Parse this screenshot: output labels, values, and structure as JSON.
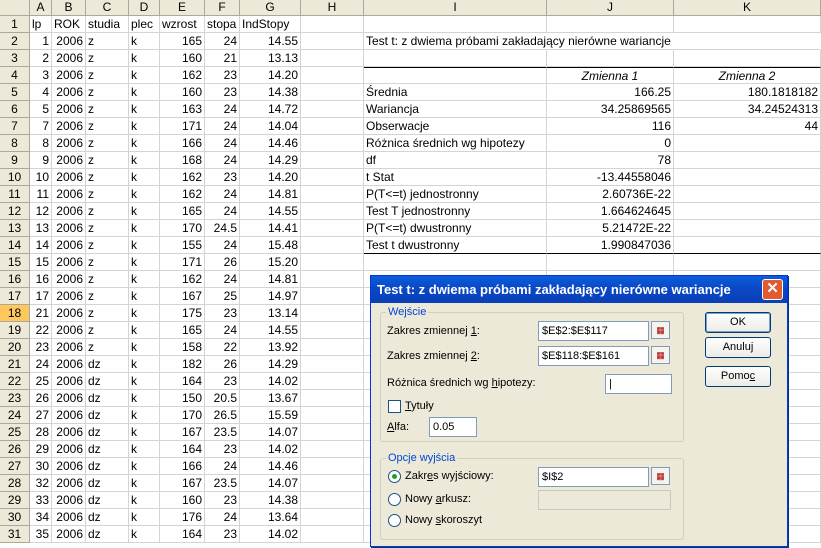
{
  "columns": [
    {
      "letter": "A",
      "w": 22
    },
    {
      "letter": "B",
      "w": 34
    },
    {
      "letter": "C",
      "w": 43
    },
    {
      "letter": "D",
      "w": 31
    },
    {
      "letter": "E",
      "w": 45
    },
    {
      "letter": "F",
      "w": 35
    },
    {
      "letter": "G",
      "w": 61
    },
    {
      "letter": "H",
      "w": 63
    },
    {
      "letter": "I",
      "w": 183
    },
    {
      "letter": "J",
      "w": 127
    },
    {
      "letter": "K",
      "w": 147
    }
  ],
  "rows": [
    {
      "n": "1",
      "lp": "lp",
      "rok": "ROK",
      "studia": "studia",
      "plec": "plec",
      "wzrost": "wzrost",
      "stopa": "stopa",
      "ind": "IndStopy"
    },
    {
      "n": "2",
      "lp": "1",
      "rok": "2006",
      "studia": "z",
      "plec": "k",
      "wzrost": "165",
      "stopa": "24",
      "ind": "14.55"
    },
    {
      "n": "3",
      "lp": "2",
      "rok": "2006",
      "studia": "z",
      "plec": "k",
      "wzrost": "160",
      "stopa": "21",
      "ind": "13.13"
    },
    {
      "n": "4",
      "lp": "3",
      "rok": "2006",
      "studia": "z",
      "plec": "k",
      "wzrost": "162",
      "stopa": "23",
      "ind": "14.20"
    },
    {
      "n": "5",
      "lp": "4",
      "rok": "2006",
      "studia": "z",
      "plec": "k",
      "wzrost": "160",
      "stopa": "23",
      "ind": "14.38"
    },
    {
      "n": "6",
      "lp": "5",
      "rok": "2006",
      "studia": "z",
      "plec": "k",
      "wzrost": "163",
      "stopa": "24",
      "ind": "14.72"
    },
    {
      "n": "7",
      "lp": "7",
      "rok": "2006",
      "studia": "z",
      "plec": "k",
      "wzrost": "171",
      "stopa": "24",
      "ind": "14.04"
    },
    {
      "n": "8",
      "lp": "8",
      "rok": "2006",
      "studia": "z",
      "plec": "k",
      "wzrost": "166",
      "stopa": "24",
      "ind": "14.46"
    },
    {
      "n": "9",
      "lp": "9",
      "rok": "2006",
      "studia": "z",
      "plec": "k",
      "wzrost": "168",
      "stopa": "24",
      "ind": "14.29"
    },
    {
      "n": "10",
      "lp": "10",
      "rok": "2006",
      "studia": "z",
      "plec": "k",
      "wzrost": "162",
      "stopa": "23",
      "ind": "14.20"
    },
    {
      "n": "11",
      "lp": "11",
      "rok": "2006",
      "studia": "z",
      "plec": "k",
      "wzrost": "162",
      "stopa": "24",
      "ind": "14.81"
    },
    {
      "n": "12",
      "lp": "12",
      "rok": "2006",
      "studia": "z",
      "plec": "k",
      "wzrost": "165",
      "stopa": "24",
      "ind": "14.55"
    },
    {
      "n": "13",
      "lp": "13",
      "rok": "2006",
      "studia": "z",
      "plec": "k",
      "wzrost": "170",
      "stopa": "24.5",
      "ind": "14.41"
    },
    {
      "n": "14",
      "lp": "14",
      "rok": "2006",
      "studia": "z",
      "plec": "k",
      "wzrost": "155",
      "stopa": "24",
      "ind": "15.48"
    },
    {
      "n": "15",
      "lp": "15",
      "rok": "2006",
      "studia": "z",
      "plec": "k",
      "wzrost": "171",
      "stopa": "26",
      "ind": "15.20"
    },
    {
      "n": "16",
      "lp": "16",
      "rok": "2006",
      "studia": "z",
      "plec": "k",
      "wzrost": "162",
      "stopa": "24",
      "ind": "14.81"
    },
    {
      "n": "17",
      "lp": "17",
      "rok": "2006",
      "studia": "z",
      "plec": "k",
      "wzrost": "167",
      "stopa": "25",
      "ind": "14.97"
    },
    {
      "n": "18",
      "lp": "21",
      "rok": "2006",
      "studia": "z",
      "plec": "k",
      "wzrost": "175",
      "stopa": "23",
      "ind": "13.14"
    },
    {
      "n": "19",
      "lp": "22",
      "rok": "2006",
      "studia": "z",
      "plec": "k",
      "wzrost": "165",
      "stopa": "24",
      "ind": "14.55"
    },
    {
      "n": "20",
      "lp": "23",
      "rok": "2006",
      "studia": "z",
      "plec": "k",
      "wzrost": "158",
      "stopa": "22",
      "ind": "13.92"
    },
    {
      "n": "21",
      "lp": "24",
      "rok": "2006",
      "studia": "dz",
      "plec": "k",
      "wzrost": "182",
      "stopa": "26",
      "ind": "14.29"
    },
    {
      "n": "22",
      "lp": "25",
      "rok": "2006",
      "studia": "dz",
      "plec": "k",
      "wzrost": "164",
      "stopa": "23",
      "ind": "14.02"
    },
    {
      "n": "23",
      "lp": "26",
      "rok": "2006",
      "studia": "dz",
      "plec": "k",
      "wzrost": "150",
      "stopa": "20.5",
      "ind": "13.67"
    },
    {
      "n": "24",
      "lp": "27",
      "rok": "2006",
      "studia": "dz",
      "plec": "k",
      "wzrost": "170",
      "stopa": "26.5",
      "ind": "15.59"
    },
    {
      "n": "25",
      "lp": "28",
      "rok": "2006",
      "studia": "dz",
      "plec": "k",
      "wzrost": "167",
      "stopa": "23.5",
      "ind": "14.07"
    },
    {
      "n": "26",
      "lp": "29",
      "rok": "2006",
      "studia": "dz",
      "plec": "k",
      "wzrost": "164",
      "stopa": "23",
      "ind": "14.02"
    },
    {
      "n": "27",
      "lp": "30",
      "rok": "2006",
      "studia": "dz",
      "plec": "k",
      "wzrost": "166",
      "stopa": "24",
      "ind": "14.46"
    },
    {
      "n": "28",
      "lp": "32",
      "rok": "2006",
      "studia": "dz",
      "plec": "k",
      "wzrost": "167",
      "stopa": "23.5",
      "ind": "14.07"
    },
    {
      "n": "29",
      "lp": "33",
      "rok": "2006",
      "studia": "dz",
      "plec": "k",
      "wzrost": "160",
      "stopa": "23",
      "ind": "14.38"
    },
    {
      "n": "30",
      "lp": "34",
      "rok": "2006",
      "studia": "dz",
      "plec": "k",
      "wzrost": "176",
      "stopa": "24",
      "ind": "13.64"
    },
    {
      "n": "31",
      "lp": "35",
      "rok": "2006",
      "studia": "dz",
      "plec": "k",
      "wzrost": "164",
      "stopa": "23",
      "ind": "14.02"
    }
  ],
  "selected_row": "18",
  "output_table": {
    "title": "Test t: z dwiema próbami zakładający nierówne wariancje",
    "header": [
      "",
      "Zmienna 1",
      "Zmienna 2"
    ],
    "rows": [
      [
        "Średnia",
        "166.25",
        "180.1818182"
      ],
      [
        "Wariancja",
        "34.25869565",
        "34.24524313"
      ],
      [
        "Obserwacje",
        "116",
        "44"
      ],
      [
        "Różnica średnich wg hipotezy",
        "0",
        ""
      ],
      [
        "df",
        "78",
        ""
      ],
      [
        "t Stat",
        "-13.44558046",
        ""
      ],
      [
        "P(T<=t) jednostronny",
        "2.60736E-22",
        ""
      ],
      [
        "Test T jednostronny",
        "1.664624645",
        ""
      ],
      [
        "P(T<=t) dwustronny",
        "5.21472E-22",
        ""
      ],
      [
        "Test t dwustronny",
        "1.990847036",
        ""
      ]
    ]
  },
  "dialog": {
    "title": "Test t: z dwiema próbami zakładający nierówne wariancje",
    "close_glyph": "✕",
    "input_group": "Wejście",
    "range1_label_pre": "Zakres zmiennej ",
    "range1_label_key": "1",
    "range1_label_post": ":",
    "range1_value": "$E$2:$E$117",
    "range2_label_pre": "Zakres zmiennej ",
    "range2_label_key": "2",
    "range2_label_post": ":",
    "range2_value": "$E$118:$E$161",
    "hyp_label_pre": "Różnica średnich wg ",
    "hyp_label_key": "h",
    "hyp_label_post": "ipotezy:",
    "hyp_value": "",
    "labels_key": "T",
    "labels_post": "ytuły",
    "alpha_key": "A",
    "alpha_post": "lfa:",
    "alpha_value": "0.05",
    "output_group": "Opcje wyjścia",
    "out_range_pre": "Zakr",
    "out_range_key": "e",
    "out_range_post": "s wyjściowy:",
    "out_range_value": "$I$2",
    "new_sheet_pre": "Nowy ",
    "new_sheet_key": "a",
    "new_sheet_post": "rkusz:",
    "new_sheet_value": "",
    "new_book_pre": "Nowy ",
    "new_book_key": "s",
    "new_book_post": "koroszyt",
    "ok_label": "OK",
    "cancel_label": "Anuluj",
    "help_pre": "Pomo",
    "help_key": "c",
    "help_post": "",
    "range_picker_icon": "range-picker-icon"
  }
}
